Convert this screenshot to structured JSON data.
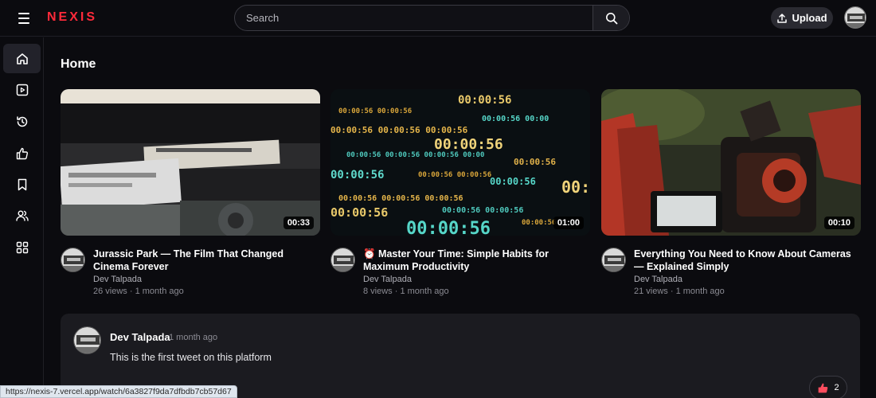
{
  "header": {
    "logo": "NEXIS",
    "search_placeholder": "Search",
    "upload_label": "Upload"
  },
  "sidebar": {
    "items": [
      {
        "name": "home",
        "active": true
      },
      {
        "name": "videos",
        "active": false
      },
      {
        "name": "history",
        "active": false
      },
      {
        "name": "liked",
        "active": false
      },
      {
        "name": "saved",
        "active": false
      },
      {
        "name": "subscriptions",
        "active": false
      },
      {
        "name": "dashboard",
        "active": false
      }
    ]
  },
  "main": {
    "title": "Home",
    "videos": [
      {
        "title": "Jurassic Park — The Film That Changed Cinema Forever",
        "channel": "Dev Talpada",
        "stats": "26 views · 1 month ago",
        "duration": "00:33"
      },
      {
        "title": "⏰ Master Your Time: Simple Habits for Maximum Productivity",
        "channel": "Dev Talpada",
        "stats": "8 views · 1 month ago",
        "duration": "01:00"
      },
      {
        "title": "Everything You Need to Know About Cameras — Explained Simply",
        "channel": "Dev Talpada",
        "stats": "21 views · 1 month ago",
        "duration": "00:10"
      }
    ]
  },
  "tweet": {
    "author": "Dev Talpada",
    "time": "1 month ago",
    "content": "This is the first tweet on this platform",
    "likes": "2"
  },
  "status_bar": {
    "url": "https://nexis-7.vercel.app/watch/6a3827f9da7dfbdb7cb57d67"
  },
  "colors": {
    "brand": "#ff2a3a",
    "background": "#0b0b0f",
    "card": "#1b1b20",
    "like": "#ff4d5e"
  }
}
